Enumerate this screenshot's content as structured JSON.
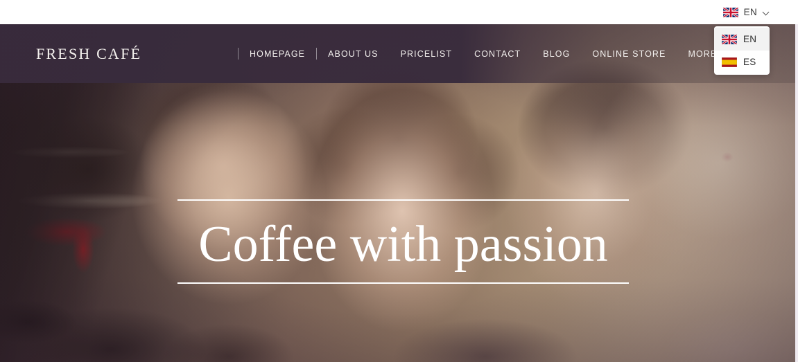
{
  "site": {
    "logo": "FRESH CAFÉ"
  },
  "topbar": {
    "language_selector": {
      "current": "EN",
      "flag_icon": "uk-flag-icon",
      "chevron_icon": "chevron-down-icon",
      "expanded": true,
      "options": [
        {
          "code": "EN",
          "flag_icon": "uk-flag-icon",
          "selected": true
        },
        {
          "code": "ES",
          "flag_icon": "spain-flag-icon",
          "selected": false
        }
      ]
    }
  },
  "nav": {
    "items": [
      {
        "label": "HOMEPAGE",
        "has_dropdown": false
      },
      {
        "label": "ABOUT US",
        "has_dropdown": false
      },
      {
        "label": "PRICELIST",
        "has_dropdown": false
      },
      {
        "label": "CONTACT",
        "has_dropdown": false
      },
      {
        "label": "BLOG",
        "has_dropdown": false
      },
      {
        "label": "ONLINE STORE",
        "has_dropdown": false
      },
      {
        "label": "MORE",
        "has_dropdown": true
      }
    ]
  },
  "hero": {
    "title": "Coffee with passion"
  },
  "colors": {
    "header_background": "#382B3C",
    "topbar_background": "#FFFFFF",
    "nav_text": "#F3F0EE",
    "hero_text": "#FFFFFF",
    "menu_hover": "#F2F2F2"
  }
}
